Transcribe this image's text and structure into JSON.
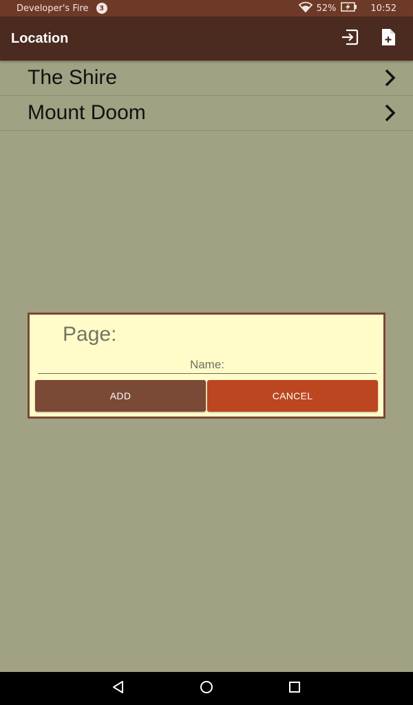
{
  "status_bar": {
    "app_name": "Developer's Fire",
    "notification_count": "3",
    "battery": "52%",
    "time": "10:52"
  },
  "app_bar": {
    "title": "Location",
    "actions": [
      {
        "icon": "import-icon"
      },
      {
        "icon": "new-file-icon"
      }
    ]
  },
  "list": {
    "items": [
      {
        "label": "The Shire"
      },
      {
        "label": "Mount Doom"
      }
    ]
  },
  "dialog": {
    "title": "Page:",
    "name_placeholder": "Name:",
    "name_value": "",
    "add_label": "ADD",
    "cancel_label": "CANCEL"
  },
  "nav_bar": {
    "buttons": [
      "back-icon",
      "home-icon",
      "recents-icon"
    ]
  },
  "colors": {
    "status_bar": "#6e3a28",
    "app_bar": "#4b2a1f",
    "background": "#a1a183",
    "dialog_bg": "#fffcca",
    "dialog_border": "#7a4632",
    "add_button": "#7a4a36",
    "cancel_button": "#bb4620"
  }
}
